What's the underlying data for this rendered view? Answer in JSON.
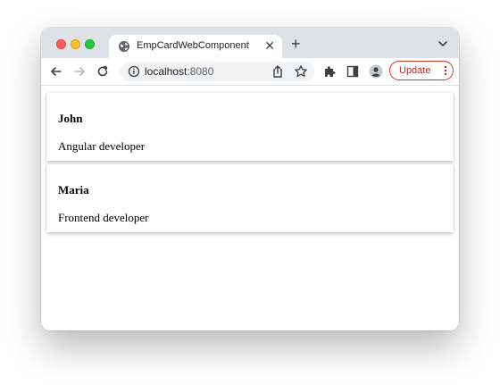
{
  "browser": {
    "tab": {
      "title": "EmpCardWebComponent"
    },
    "address": {
      "host": "localhost",
      "port": ":8080"
    },
    "update_label": "Update"
  },
  "employees": [
    {
      "name": "John",
      "role": "Angular developer"
    },
    {
      "name": "Maria",
      "role": "Frontend developer"
    }
  ],
  "icons": {
    "tab_favicon": "globe-icon",
    "tab_close": "close-icon",
    "new_tab": "plus-icon",
    "tab_search": "chevron-down-icon",
    "back": "arrow-left-icon",
    "forward": "arrow-right-icon",
    "reload": "reload-icon",
    "site_info": "info-icon",
    "share": "share-icon",
    "bookmark": "star-icon",
    "extensions": "puzzle-icon",
    "side_panel": "side-panel-icon",
    "profile": "profile-icon",
    "menu": "kebab-menu-icon"
  },
  "colors": {
    "titlebar": "#dee1e6",
    "update_accent": "#d93025"
  }
}
